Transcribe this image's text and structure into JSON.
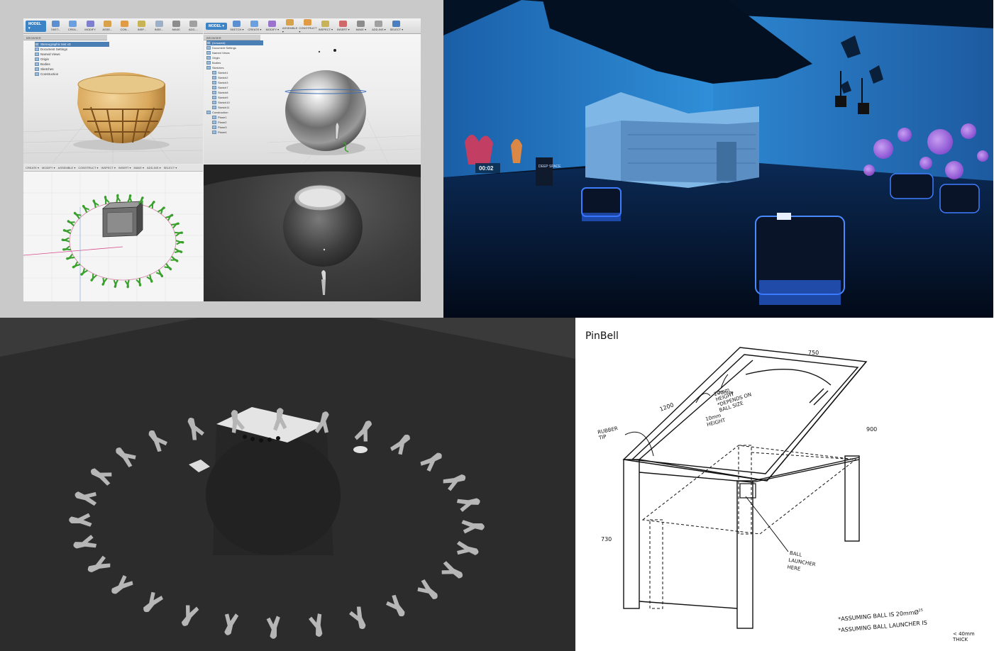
{
  "cad": {
    "left_ui": {
      "mode": "MODEL ▾",
      "toolbar": [
        "SKET...",
        "CREA...",
        "MODIFY",
        "ASSE...",
        "CON...",
        "INSP...",
        "INSE...",
        "MAKE",
        "ADD-...",
        "SELECT"
      ],
      "browser_label": "BROWSER",
      "doc_title": "Stereographic test v3",
      "tree": [
        "Document Settings",
        "Named Views",
        "Origin",
        "Bodies",
        "Sketches",
        "Construction"
      ]
    },
    "right_ui": {
      "mode": "MODEL ▾",
      "toolbar": [
        "SKETCH ▾",
        "CREATE ▾",
        "MODIFY ▾",
        "ASSEMBLE ▾",
        "CONSTRUCT ▾",
        "INSPECT ▾",
        "INSERT ▾",
        "MAKE ▾",
        "ADD-INS ▾",
        "SELECT ▾"
      ],
      "browser_label": "BROWSER",
      "doc_title": "(Unsaved)",
      "tree": [
        "Document Settings",
        "Named Views",
        "Origin",
        "Bodies",
        "Sketches",
        "Sketch1",
        "Sketch2",
        "Sketch3",
        "Sketch7",
        "Sketch8",
        "Sketch9",
        "Sketch10",
        "Sketch11",
        "Construction",
        "Plane1",
        "Plane2",
        "Plane3",
        "Plane4"
      ]
    },
    "sketch_toolbar": [
      "CREATE ▾",
      "MODIFY ▾",
      "ASSEMBLE ▾",
      "CONSTRUCT ▾",
      "INSPECT ▾",
      "INSERT ▾",
      "MAKE ▾",
      "ADD-INS ▾",
      "SELECT ▾"
    ]
  },
  "exhibit": {
    "timer": "00:02",
    "sign": "DEEP SPACE"
  },
  "drawing": {
    "title": "PinBell",
    "dim_top": "750",
    "dim_side_left": "1200",
    "dim_right": "900",
    "dim_height": "730",
    "note_20mm": "20mm\nHEIGHT\n*DEPENDS ON\nBALL SIZE",
    "note_10mm": "10mm\nHEIGHT",
    "note_rubber": "RUBBER\nTIP",
    "note_ball": "BALL\nLAUNCHER\nHERE",
    "note_assume1": "*ASSUMING BALL IS 20mmØ",
    "note_assume1_sup": "25",
    "note_assume2": "*ASSUMING BALL LAUNCHER IS",
    "note_assume3": "< 40mm\nTHICK"
  },
  "colors": {
    "fusion_blue": "#3c84c6",
    "exhibit_glow": "#1f6cff",
    "sketch_green": "#3aa02d"
  }
}
